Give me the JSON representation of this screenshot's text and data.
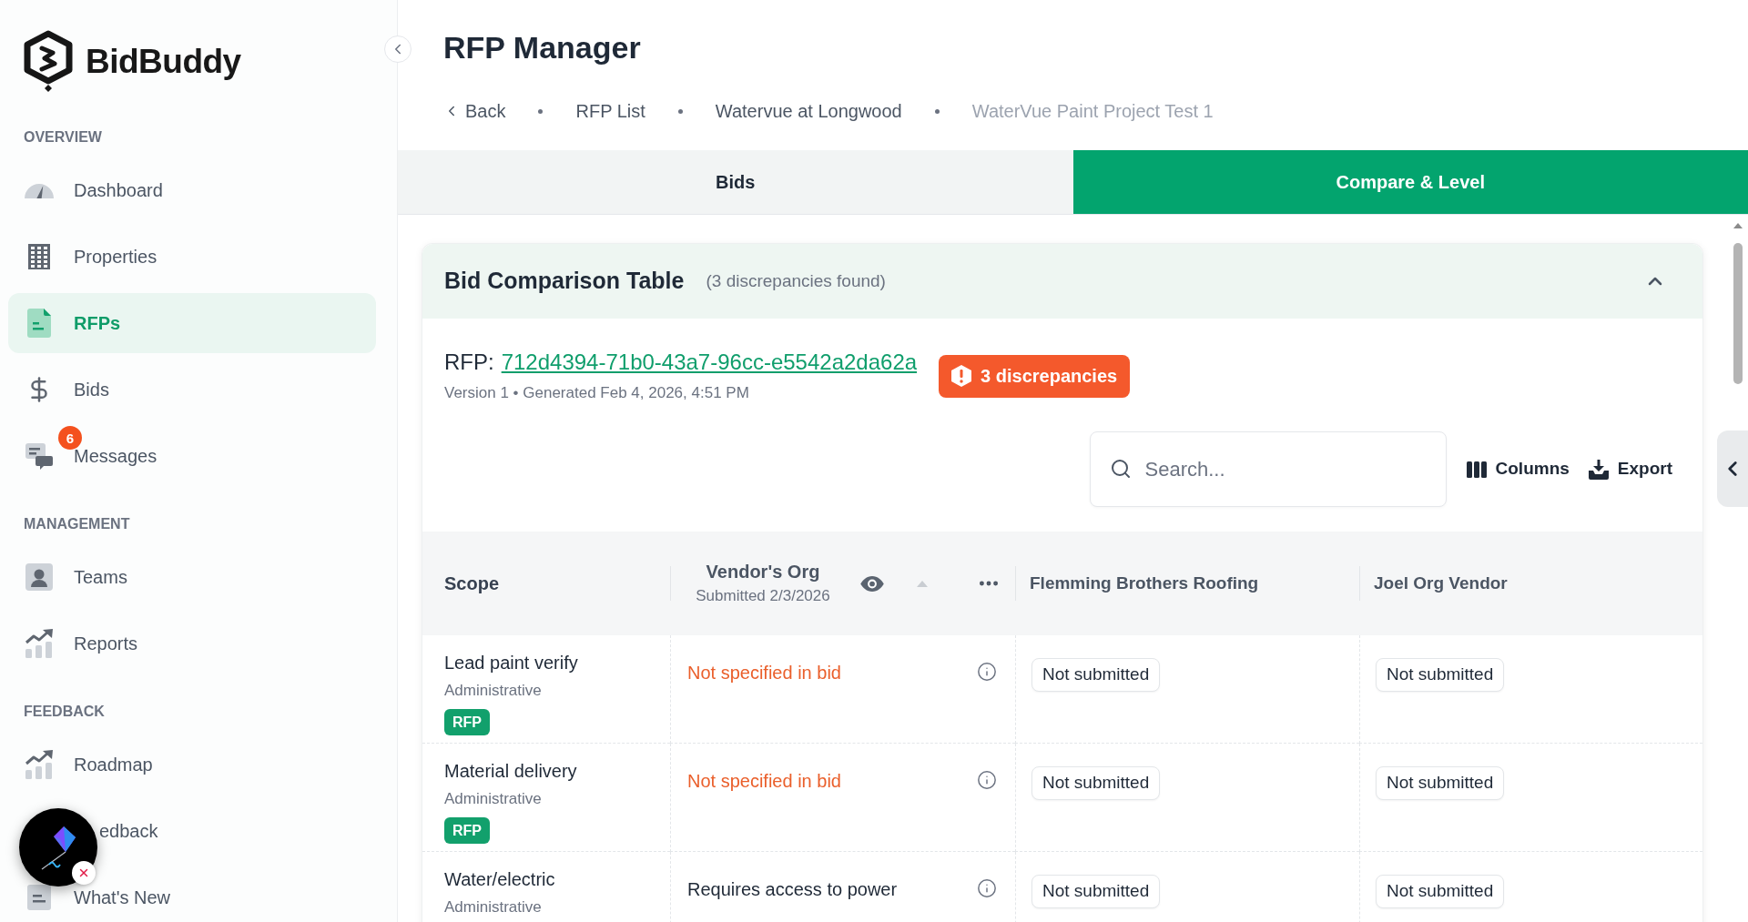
{
  "sidebar": {
    "logo": "BidBuddy",
    "sections": [
      {
        "title": "OVERVIEW",
        "items": [
          {
            "label": "Dashboard",
            "selected": false,
            "covered": false
          },
          {
            "label": "Properties",
            "selected": false,
            "covered": false
          },
          {
            "label": "RFPs",
            "selected": true,
            "covered": false
          },
          {
            "label": "Bids",
            "selected": false,
            "covered": false
          },
          {
            "label": "Messages",
            "selected": false,
            "covered": false,
            "badge": "6"
          }
        ]
      },
      {
        "title": "MANAGEMENT",
        "items": [
          {
            "label": "Teams",
            "selected": false,
            "covered": false
          },
          {
            "label": "Reports",
            "selected": false,
            "covered": false
          }
        ]
      },
      {
        "title": "FEEDBACK",
        "items": [
          {
            "label": "Roadmap",
            "selected": false,
            "covered": false
          },
          {
            "label": "edback",
            "selected": false,
            "covered": true
          },
          {
            "label": "What's New",
            "selected": false,
            "covered": false
          }
        ]
      }
    ]
  },
  "header": {
    "title": "RFP Manager",
    "back": "Back",
    "breadcrumbs": [
      {
        "label": "RFP List",
        "current": false
      },
      {
        "label": "Watervue at Longwood",
        "current": false
      },
      {
        "label": "WaterVue Paint Project Test 1",
        "current": true
      }
    ]
  },
  "tabs": [
    {
      "label": "Bids",
      "selected": false
    },
    {
      "label": "Compare & Level",
      "selected": true
    }
  ],
  "comparison": {
    "title": "Bid Comparison Table",
    "summary": "(3 discrepancies found)",
    "expanded": true,
    "rfp_label": "RFP:",
    "rfp_id": "712d4394-71b0-43a7-96cc-e5542a2da62a",
    "meta": "Version 1 • Generated Feb 4, 2026, 4:51 PM",
    "badge": "3 discrepancies",
    "search": {
      "placeholder": "Search..."
    },
    "actions": [
      "Columns",
      "Export"
    ],
    "table": {
      "columns": [
        {
          "kind": "scope",
          "label": "Scope"
        },
        {
          "kind": "vendor",
          "label": "Vendor's Org",
          "subtitle": "Submitted 2/3/2026",
          "hovered": true
        },
        {
          "kind": "vendor",
          "label": "Flemming Brothers Roofing",
          "hovered": false
        },
        {
          "kind": "vendor",
          "label": "Joel Org Vendor",
          "hovered": false
        }
      ],
      "rows": [
        {
          "cells": [
            {
              "kind": "scope",
              "text": "Lead paint verify",
              "category": "Administrative",
              "tag": "RFP"
            },
            {
              "kind": "missing",
              "text": "Not specified in bid"
            },
            {
              "kind": "not_submitted",
              "text": "Not submitted"
            },
            {
              "kind": "not_submitted",
              "text": "Not submitted"
            }
          ]
        },
        {
          "cells": [
            {
              "kind": "scope",
              "text": "Material delivery",
              "category": "Administrative",
              "tag": "RFP"
            },
            {
              "kind": "missing",
              "text": "Not specified in bid"
            },
            {
              "kind": "not_submitted",
              "text": "Not submitted"
            },
            {
              "kind": "not_submitted",
              "text": "Not submitted"
            }
          ]
        },
        {
          "cells": [
            {
              "kind": "scope",
              "text": "Water/electric",
              "category": "Administrative"
            },
            {
              "kind": "value",
              "text": "Requires access to power"
            },
            {
              "kind": "not_submitted",
              "text": "Not submitted"
            },
            {
              "kind": "not_submitted",
              "text": "Not submitted"
            }
          ]
        }
      ]
    }
  }
}
